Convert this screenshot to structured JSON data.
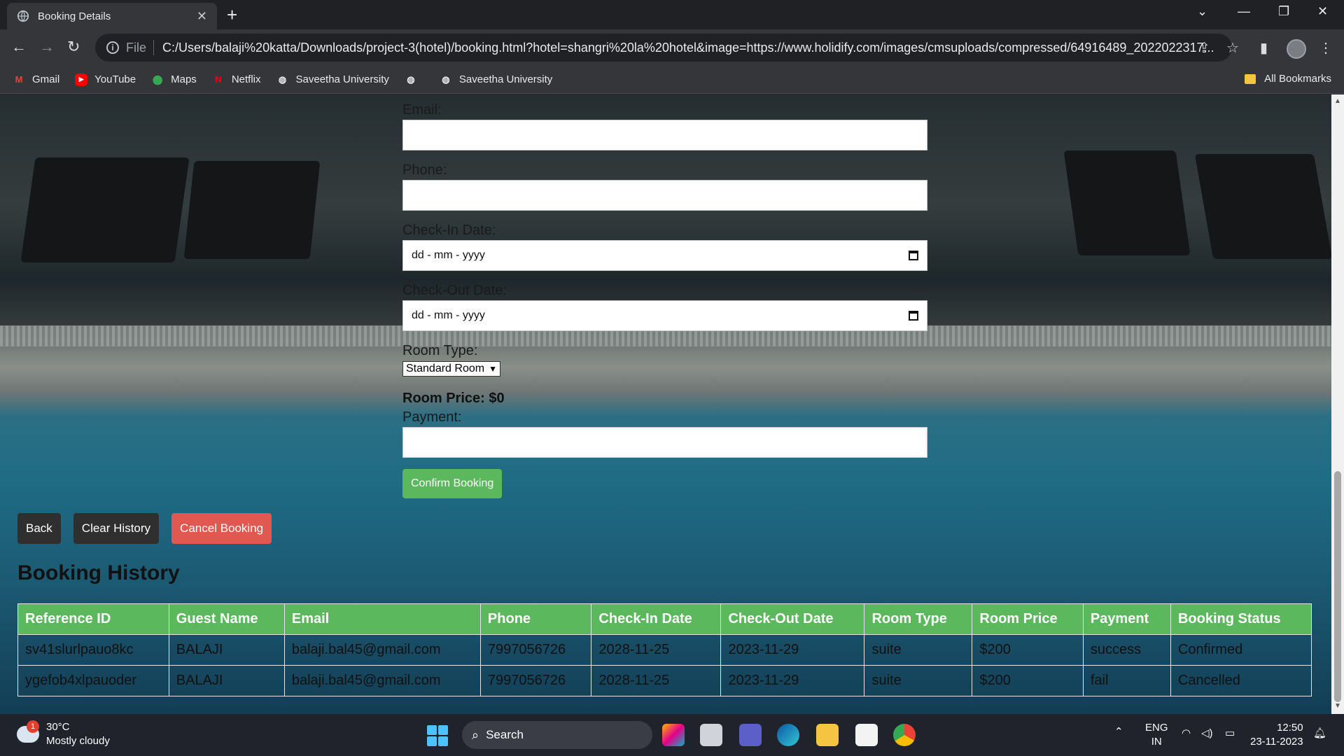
{
  "browser": {
    "tab_title": "Booking Details",
    "url_scheme": "File",
    "url": "C:/Users/balaji%20katta/Downloads/project-3(hotel)/booking.html?hotel=shangri%20la%20hotel&image=https://www.holidify.com/images/cmsuploads/compressed/64916489_2022022317...",
    "bookmarks": [
      "Gmail",
      "YouTube",
      "Maps",
      "Netflix",
      "Saveetha University",
      "Saveetha University"
    ],
    "all_bookmarks": "All Bookmarks"
  },
  "form": {
    "email_label": "Email:",
    "phone_label": "Phone:",
    "checkin_label": "Check-In Date:",
    "checkin_placeholder": "dd - mm - yyyy",
    "checkout_label": "Check-Out Date:",
    "checkout_placeholder": "dd - mm - yyyy",
    "room_type_label": "Room Type:",
    "room_type_value": "Standard Room",
    "room_price": "Room Price: $0",
    "payment_label": "Payment:",
    "confirm_label": "Confirm Booking"
  },
  "actions": {
    "back": "Back",
    "clear_history": "Clear History",
    "cancel_booking": "Cancel Booking"
  },
  "history": {
    "title": "Booking History",
    "columns": [
      "Reference ID",
      "Guest Name",
      "Email",
      "Phone",
      "Check-In Date",
      "Check-Out Date",
      "Room Type",
      "Room Price",
      "Payment",
      "Booking Status"
    ],
    "rows": [
      [
        "sv41slurlpauo8kc",
        "BALAJI",
        "balaji.bal45@gmail.com",
        "7997056726",
        "2028-11-25",
        "2023-11-29",
        "suite",
        "$200",
        "success",
        "Confirmed"
      ],
      [
        "ygefob4xlpauoder",
        "BALAJI",
        "balaji.bal45@gmail.com",
        "7997056726",
        "2028-11-25",
        "2023-11-29",
        "suite",
        "$200",
        "fail",
        "Cancelled"
      ]
    ]
  },
  "taskbar": {
    "weather_badge": "1",
    "temperature": "30°C",
    "condition": "Mostly cloudy",
    "search": "Search",
    "lang_top": "ENG",
    "lang_bottom": "IN",
    "time": "12:50",
    "date": "23-11-2023"
  },
  "colors": {
    "accent_green": "#5cb85c",
    "cancel_red": "#e0584f",
    "dark_button": "#2f2f2f"
  }
}
